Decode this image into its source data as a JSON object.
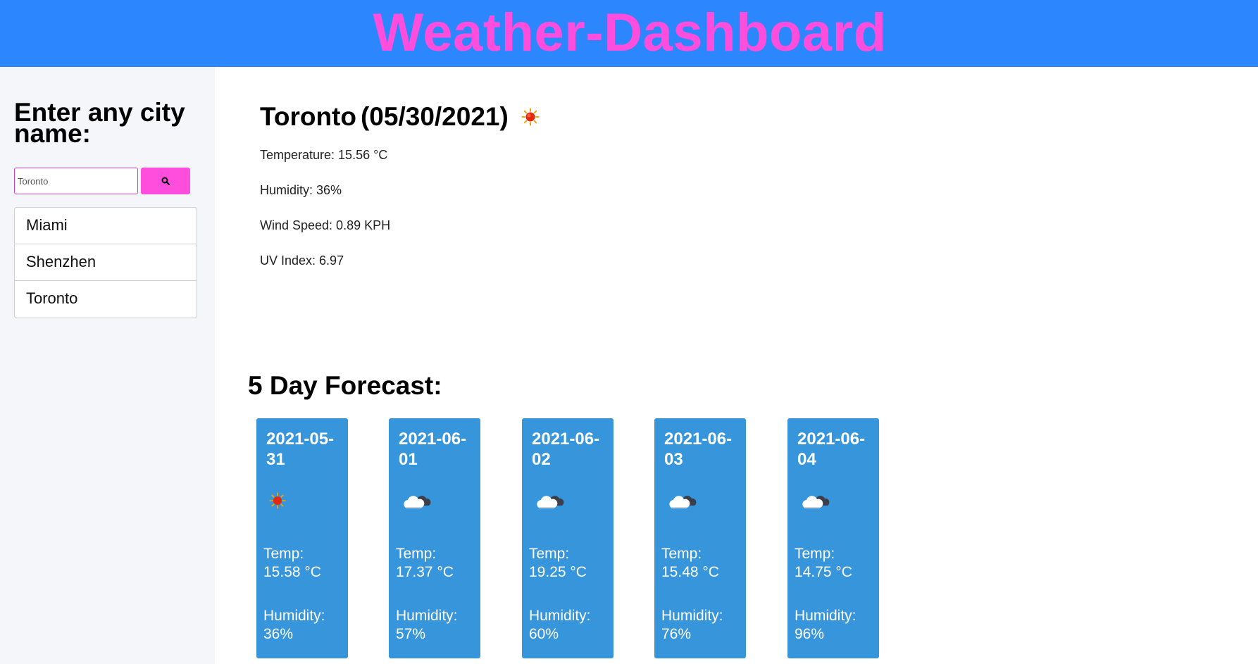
{
  "header": {
    "title": "Weather-Dashboard"
  },
  "sidebar": {
    "heading": "Enter any city name:",
    "search": {
      "value": "Toronto",
      "placeholder": "",
      "button_icon": "search-icon"
    },
    "cities": [
      "Miami",
      "Shenzhen",
      "Toronto"
    ]
  },
  "current": {
    "city": "Toronto",
    "date": "(05/30/2021)",
    "icon": "sun-icon",
    "temperature": "Temperature: 15.56 °C",
    "humidity": "Humidity: 36%",
    "wind_speed": "Wind Speed: 0.89 KPH",
    "uv_index": "UV Index: 6.97"
  },
  "forecast": {
    "title": "5 Day Forecast:",
    "temp_label": "Temp:",
    "humidity_label": "Humidity:",
    "days": [
      {
        "date": "2021-05-31",
        "icon": "sun-icon",
        "temp": "15.58 °C",
        "humidity": "36%"
      },
      {
        "date": "2021-06-01",
        "icon": "cloud-icon",
        "temp": "17.37 °C",
        "humidity": "57%"
      },
      {
        "date": "2021-06-02",
        "icon": "cloud-icon",
        "temp": "19.25 °C",
        "humidity": "60%"
      },
      {
        "date": "2021-06-03",
        "icon": "cloud-icon",
        "temp": "15.48 °C",
        "humidity": "76%"
      },
      {
        "date": "2021-06-04",
        "icon": "cloud-icon",
        "temp": "14.75 °C",
        "humidity": "96%"
      }
    ]
  },
  "colors": {
    "header_bg": "#2c86fd",
    "title_pink": "#ff4dde",
    "card_bg": "#3796db",
    "sidebar_bg": "#f4f6f9"
  }
}
